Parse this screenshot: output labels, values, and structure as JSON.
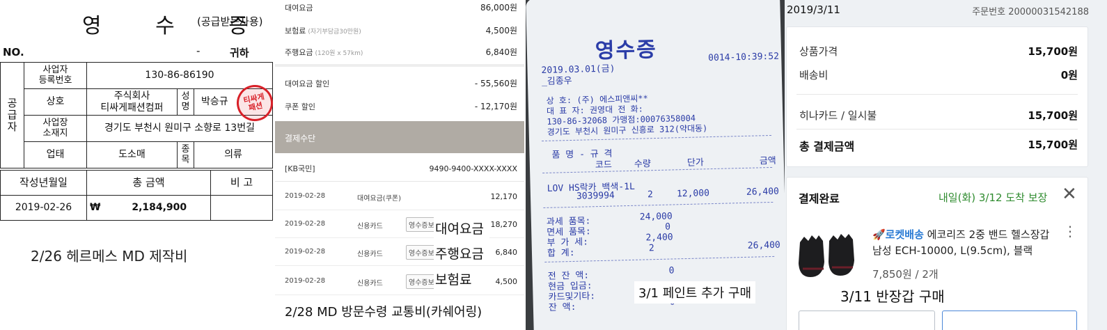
{
  "receipt": {
    "title": "영 수 증",
    "subtitle": "(공급받는자용)",
    "no_label": "NO.",
    "dash": "-",
    "to_label": "귀하",
    "supplier_label": "공\n급\n자",
    "reg_label": "사업자\n등록번호",
    "reg_no": "130-86-86190",
    "company_label": "상호",
    "company_name": "주식회사\n티싸게패션컴퍼",
    "name_label": "성\n명",
    "owner_name": "박승규",
    "address_label": "사업장\n소재지",
    "address": "경기도 부천시 원미구 소향로 13번길",
    "biztype_label": "업태",
    "biztype": "도소매",
    "item_label": "종\n목",
    "item": "의류",
    "date_label": "작성년월일",
    "total_label": "총 금액",
    "note_label": "비 고",
    "date": "2019-02-26",
    "currency": "₩",
    "total": "2,184,900",
    "stamp_text": "티싸게\n패션",
    "caption": "2/26 헤르메스 MD 제작비"
  },
  "carshare": {
    "rows": [
      {
        "label": "대여요금",
        "sub": "",
        "amount": "86,000원"
      },
      {
        "label": "보험료",
        "sub": "(자기부담금30만원)",
        "amount": "4,500원"
      },
      {
        "label": "주행요금",
        "sub": "(120원 x 57km)",
        "amount": "6,840원"
      }
    ],
    "discounts": [
      {
        "label": "대여요금 할인",
        "amount": "- 55,560원"
      },
      {
        "label": "쿠폰 할인",
        "amount": "- 12,170원"
      }
    ],
    "pay_header": "결제수단",
    "card_name": "[KB국민]",
    "card_no": "9490-9400-XXXX-XXXX",
    "transactions": [
      {
        "date": "2019-02-28",
        "kind": "대여요금(쿠폰)",
        "button": "",
        "amount": "12,170"
      },
      {
        "date": "2019-02-28",
        "kind": "신용카드",
        "button": "영수증보기",
        "amount": "18,270"
      },
      {
        "date": "2019-02-28",
        "kind": "신용카드",
        "button": "영수증보기",
        "amount": "6,840"
      },
      {
        "date": "2019-02-28",
        "kind": "신용카드",
        "button": "영수증보기",
        "amount": "4,500"
      }
    ],
    "overlays": [
      "대여요금",
      "주행요금",
      "보험료"
    ],
    "caption": "2/28 MD 방문수령 교통비(카쉐어링)"
  },
  "paper_receipt": {
    "title": "영수증",
    "date": "2019.03.01(금)",
    "time": "0014-10:39:52",
    "cashier": "_김종우",
    "store_line": "상    호: (주) 에스피앤씨**",
    "ceo_line": "대 표 자: 권영대   전  화:",
    "reg_line": "130-86-32068     가맹점:00076358004",
    "addr_line": "경기도 부천시 원미구 신흥로 312(약대동)",
    "header1": "품  명 - 규  격",
    "header2_code": "코드",
    "header2_qty": "수량",
    "header2_price": "단가",
    "header2_amount": "금액",
    "item_name": "LOV HS락카 백색-1L",
    "item_code": "3039994",
    "item_qty": "2",
    "item_price": "12,000",
    "item_amount": "26,400",
    "taxable_label": "과세  품목:",
    "taxable_value": "24,000",
    "exempt_label": "면세  품목:",
    "exempt_value": "0",
    "vat_label": "부  가  세:",
    "vat_value": "2,400",
    "sum_label": "합      계:",
    "sum_qty": "2",
    "sum_value": "26,400",
    "prev_label": "전  잔  액:",
    "prev_value": "0",
    "cash_label": "현금  입금:",
    "card_label": "카드및기타:",
    "bal_label": "잔      액:",
    "bal_value": "0",
    "caption": "3/1 페인트 추가 구매"
  },
  "shop": {
    "date": "2019/3/11",
    "order_no": "주문번호 20000031542188",
    "price_label": "상품가격",
    "price_value": "15,700원",
    "ship_label": "배송비",
    "ship_value": "0원",
    "card_label": "히나카드 / 일시불",
    "card_value": "15,700원",
    "total_label": "총 결제금액",
    "total_value": "15,700원",
    "status": "결제완료",
    "eta": "내일(화) 3/12 도착 보장",
    "rocket": "🚀로켓배송",
    "product": " 에코리즈 2중 밴드 헬스장갑 남성 ECH-10000, L(9.5cm), 블랙",
    "unit_price": "7,850원 / 2개",
    "close_glyph": "✕",
    "more_glyph": "⋮",
    "caption": "3/11 반장갑 구매"
  }
}
